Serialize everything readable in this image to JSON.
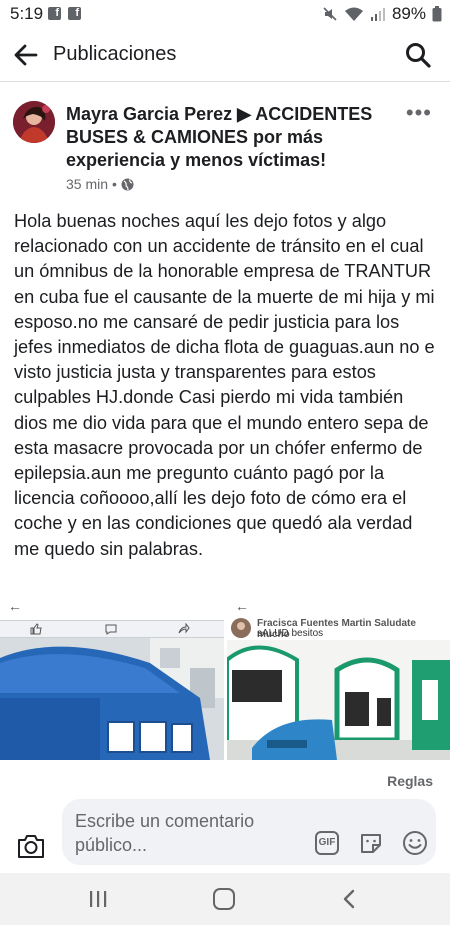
{
  "status_bar": {
    "time": "5:19",
    "battery": "89%",
    "icons": [
      "facebook-notification-icon",
      "facebook-notification-icon",
      "mute-icon",
      "wifi-icon",
      "signal-icon",
      "battery-icon"
    ]
  },
  "header": {
    "title": "Publicaciones",
    "back_icon": "arrow-left-icon",
    "search_icon": "search-icon"
  },
  "post": {
    "author": "Mayra Garcia Perez ▶ ACCIDENTES BUSES & CAMIONES por más experiencia y menos víctimas!",
    "time": "35 min",
    "separator": "•",
    "privacy_icon": "globe-icon",
    "more_icon": "more-icon",
    "more_label": "•••",
    "body": "Hola buenas noches aquí les dejo fotos y algo relacionado con un accidente de tránsito en el cual un ómnibus de la honorable empresa de TRANTUR en cuba fue el causante de la muerte de mi hija y mi esposo.no me cansaré de pedir justicia para los jefes inmediatos de dicha flota de guaguas.aun no e visto justicia justa y transparentes para estos culpables HJ.donde Casi pierdo mi vida también dios me dio vida para que el mundo entero sepa de esta masacre provocada por un chófer enfermo de epilepsia.aun me pregunto cuánto pagó por la licencia coñoooo,allí les dejo foto de cómo era el coche y en las condiciones que quedó ala verdad me quedo sin palabras."
  },
  "images": {
    "left": {
      "back_label": "←"
    },
    "right": {
      "back_label": "←",
      "comment_name": "Fracisca Fuentes Martin Saludate mucho",
      "comment_text": "sALUD besitos"
    }
  },
  "reglas": "Reglas",
  "composer": {
    "placeholder": "Escribe un comentario público...",
    "gif_label": "GIF"
  },
  "colors": {
    "accent": "#1877f2",
    "text": "#1c1e21",
    "secondary": "#65676b",
    "composer_bg": "#f0f2f5"
  }
}
